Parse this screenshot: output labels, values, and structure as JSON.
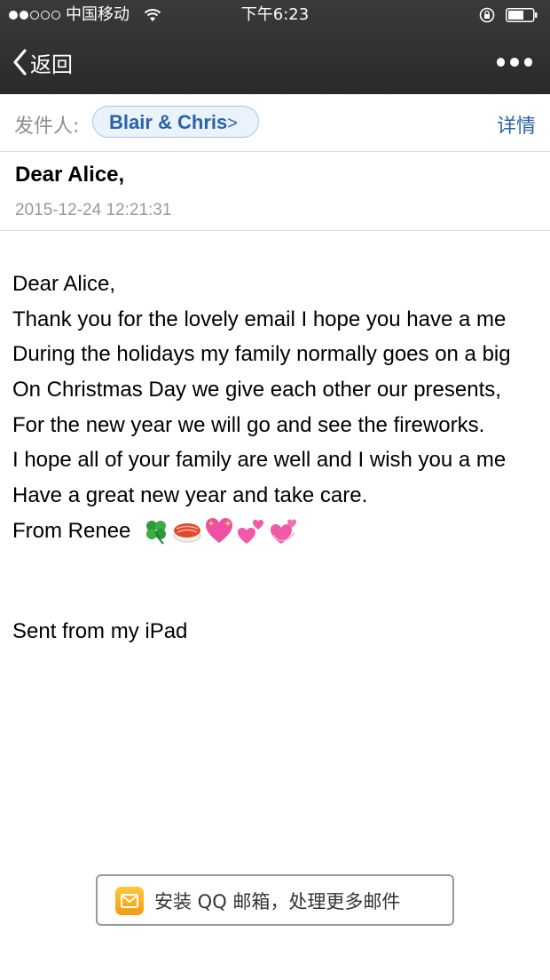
{
  "status_bar": {
    "carrier": "中国移动",
    "time": "下午6:23"
  },
  "nav": {
    "back_label": "返回"
  },
  "sender": {
    "label": "发件人:",
    "name": "Blair & Chris",
    "chevron": ">",
    "details_label": "详情"
  },
  "email": {
    "subject": "Dear Alice,",
    "date": "2015-12-24 12:21:31",
    "body_lines": [
      "Dear Alice,",
      "Thank you for the lovely email I hope you have a me",
      "During the holidays my family normally goes on a big",
      "On Christmas Day we give each other our presents,",
      "For the new year we will go and see the fireworks.",
      "I hope all of your family are well and I wish you a me",
      "Have a great new year and take care.",
      "From Renee"
    ],
    "emojis": [
      "four-leaf-clover",
      "sushi",
      "sparkling-heart",
      "two-hearts",
      "revolving-hearts"
    ],
    "signature": "Sent from my iPad"
  },
  "banner": {
    "text": "安装 QQ 邮箱，处理更多邮件",
    "icon": "mail-icon"
  },
  "colors": {
    "link_blue": "#2b62a8",
    "topbar": "#333335",
    "muted_gray": "#8e8e93"
  }
}
